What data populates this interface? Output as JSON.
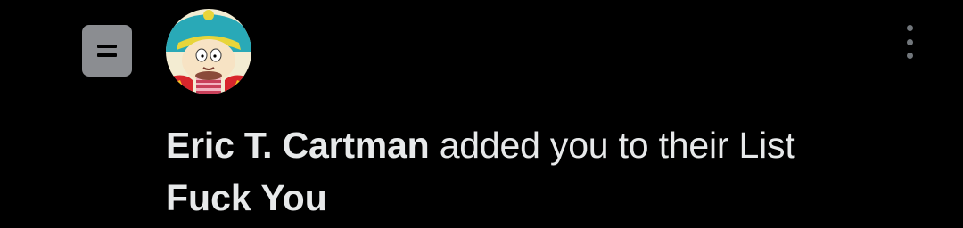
{
  "notification": {
    "user_name": "Eric T. Cartman",
    "action_text": "added you to their List",
    "list_name": "Fuck You"
  },
  "icons": {
    "list": "list-icon",
    "more": "more-options-icon"
  },
  "colors": {
    "background": "#000000",
    "text": "#e7e9ea",
    "icon_fill": "#8b8d91",
    "more_dots": "#71767b"
  }
}
